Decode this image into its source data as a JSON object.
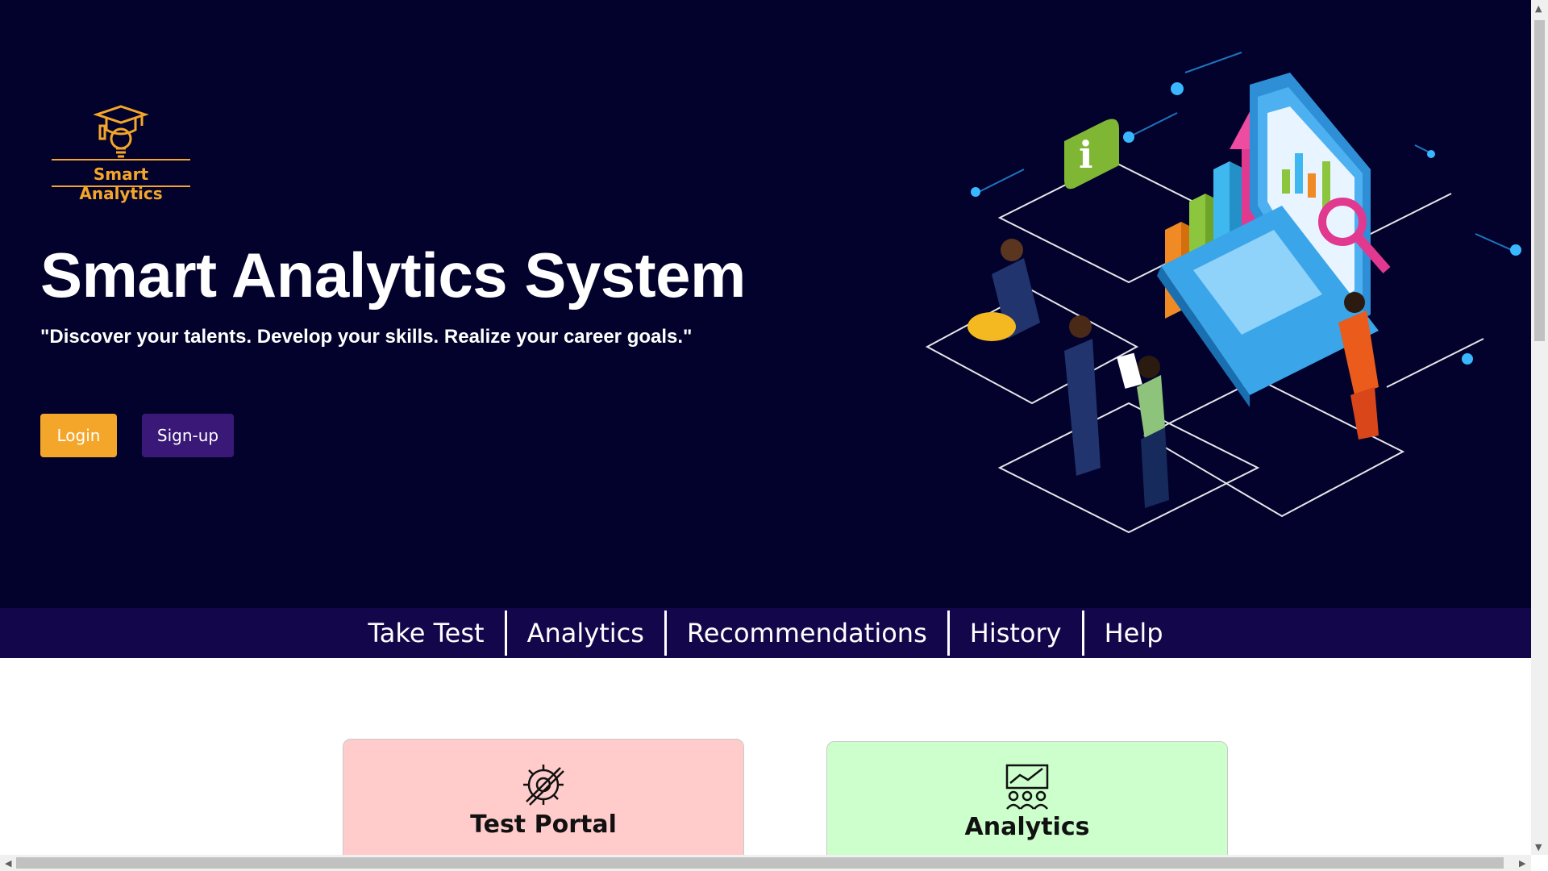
{
  "logo": {
    "text": "Smart Analytics",
    "icon": "graduation-cap-bulb-icon",
    "color": "#f4a62a"
  },
  "hero": {
    "title": "Smart Analytics System",
    "tagline": "\"Discover your talents. Develop your skills. Realize your career goals.\"",
    "login_label": "Login",
    "signup_label": "Sign-up",
    "illustration": "isometric-analytics-laptop-illustration",
    "background_color": "#03022c"
  },
  "nav": {
    "items": [
      "Take Test",
      "Analytics",
      "Recommendations",
      "History",
      "Help"
    ],
    "background_color": "#14064a"
  },
  "cards": [
    {
      "title": "Test Portal",
      "icon": "gear-crossed-tools-icon",
      "color": "#ffcccb"
    },
    {
      "title": "Analytics",
      "icon": "analytics-chart-people-icon",
      "color": "#ccffcc"
    }
  ],
  "colors": {
    "accent": "#f4a62a",
    "secondary": "#3a1878"
  }
}
